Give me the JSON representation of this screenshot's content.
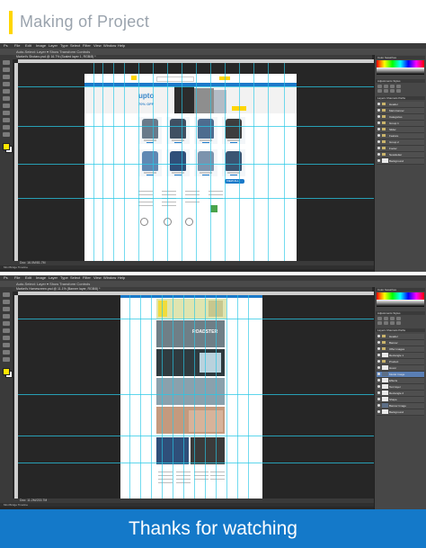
{
  "header": {
    "title": "Making of Project",
    "accent": "#ffd600"
  },
  "ps_menu": [
    "File",
    "Edit",
    "Image",
    "Layer",
    "Type",
    "Select",
    "Filter",
    "View",
    "Window",
    "Help"
  ],
  "window1": {
    "options_text": "Auto-Select:  Layer  ▾   Show Transform Controls",
    "tab_text": "Market's Shotaro.psd @ 16.7% (Scaled layer 1, RGB/8) *",
    "status_text": "Doc: 16.0M/81.7M",
    "doc_tabs": "Mini Bridge   Timeline",
    "site": {
      "upto_big": "upto",
      "upto_small": "70% OFF",
      "view_all": "VIEW ALL"
    },
    "panels": {
      "color_tab": "Color   Swatches",
      "adjust_tab": "Adjustments   Styles",
      "layers_tab": "Layers   Channels   Paths"
    },
    "layers": [
      {
        "name": "Header",
        "type": "folder"
      },
      {
        "name": "Main banner",
        "type": "folder"
      },
      {
        "name": "Categories",
        "type": "folder"
      },
      {
        "name": "Group 1",
        "type": "folder"
      },
      {
        "name": "Slider",
        "type": "folder"
      },
      {
        "name": "Feature",
        "type": "folder"
      },
      {
        "name": "Group 2",
        "type": "folder"
      },
      {
        "name": "Footer",
        "type": "folder"
      },
      {
        "name": "Newsletter",
        "type": "folder"
      },
      {
        "name": "Background",
        "type": "layer"
      }
    ]
  },
  "window2": {
    "tab_text": "Market's Homescreen.psd @ 11.1% (Banner layer, RGB/8) *",
    "status_text": "Doc: 11.2M/233.7M",
    "doc_tabs": "Mini Bridge   Timeline",
    "site": {
      "roadster": "ROADSTER"
    },
    "panels": {
      "color_tab": "Color   Swatches",
      "adjust_tab": "Adjustments   Styles",
      "layers_tab": "Layers   Channels   Paths"
    },
    "layers": [
      {
        "name": "Header",
        "type": "folder"
      },
      {
        "name": "Banner",
        "type": "folder"
      },
      {
        "name": "Offer images",
        "type": "folder"
      },
      {
        "name": "Rectangle 1",
        "type": "layer"
      },
      {
        "name": "Product",
        "type": "folder"
      },
      {
        "name": "Hover",
        "type": "layer"
      },
      {
        "name": "Model Image",
        "type": "image"
      },
      {
        "name": "Effects",
        "type": "layer"
      },
      {
        "name": "Text layer",
        "type": "layer"
      },
      {
        "name": "Rectangle 2",
        "type": "layer"
      },
      {
        "name": "Shape",
        "type": "layer"
      },
      {
        "name": "Banner Image",
        "type": "image"
      },
      {
        "name": "Background",
        "type": "layer"
      }
    ]
  },
  "footer": {
    "text": "Thanks for watching",
    "color": "#1479c9"
  }
}
